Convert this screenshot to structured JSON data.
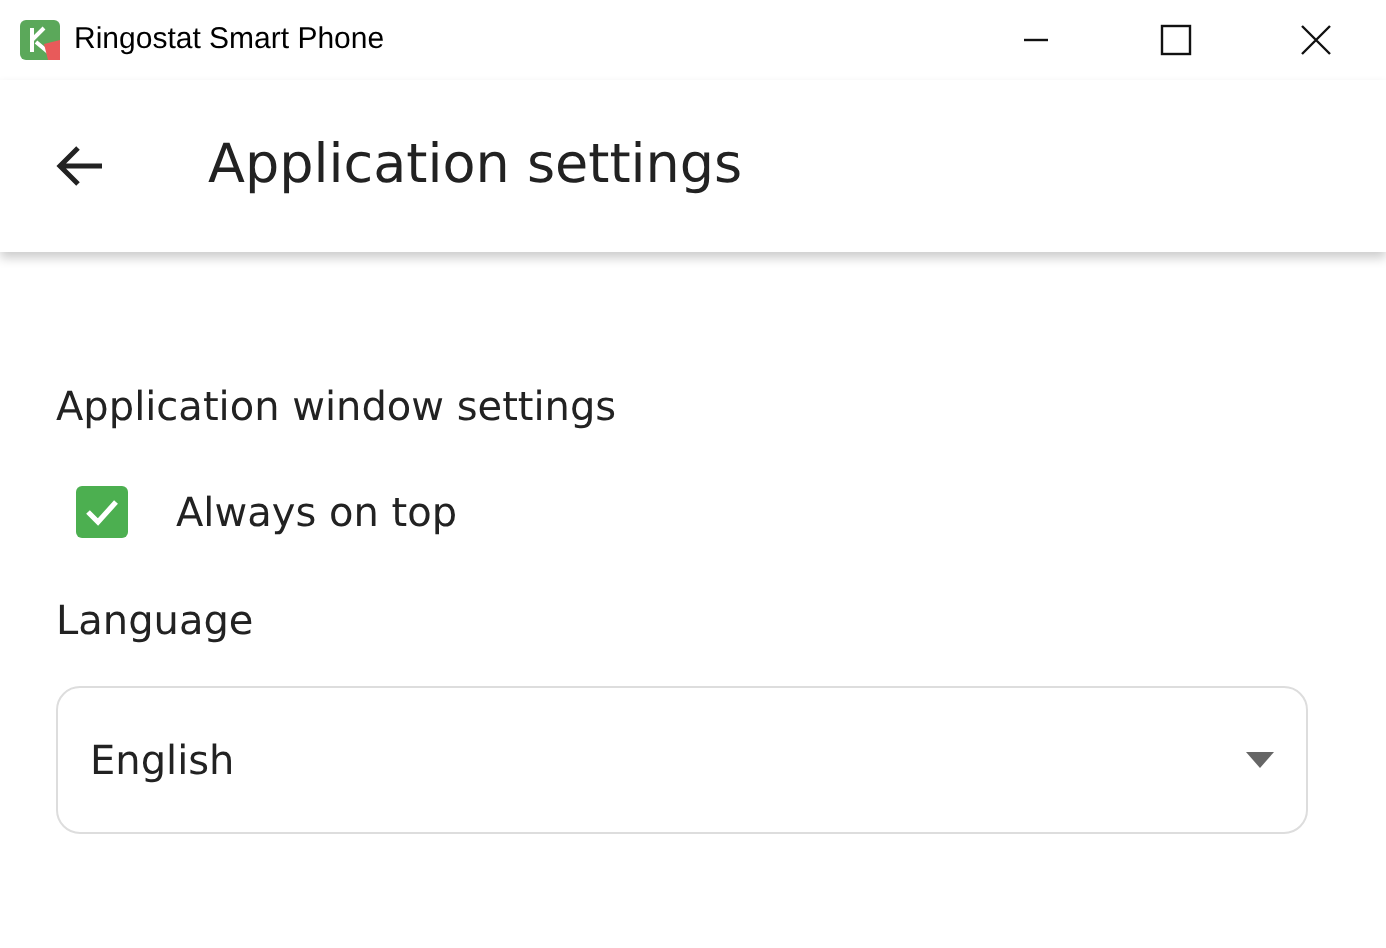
{
  "window": {
    "title": "Ringostat Smart Phone"
  },
  "app_bar": {
    "title": "Application settings"
  },
  "section": {
    "title": "Application window settings"
  },
  "always_on_top": {
    "label": "Always on top",
    "checked": true
  },
  "language": {
    "label": "Language",
    "value": "English"
  }
}
